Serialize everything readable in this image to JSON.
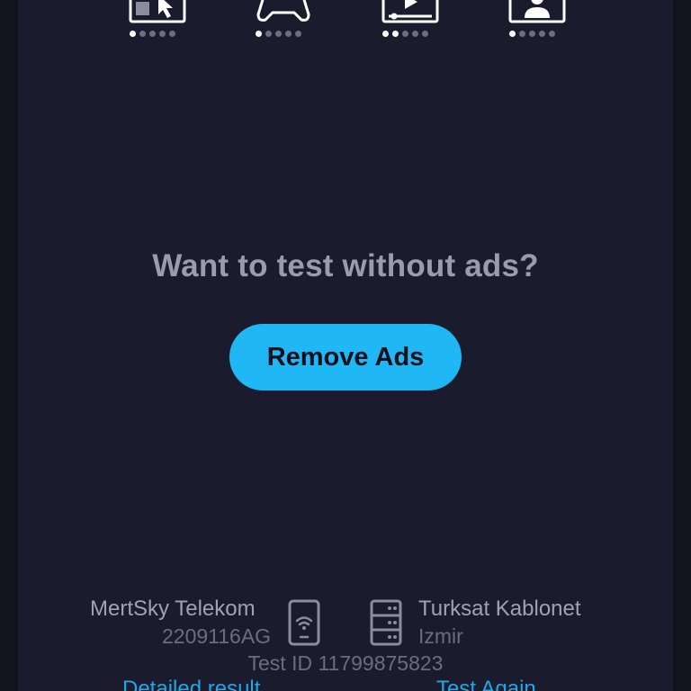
{
  "activities": [
    {
      "icon": "browsing-icon",
      "dots": 5,
      "active_dots": 1
    },
    {
      "icon": "gamepad-icon",
      "dots": 5,
      "active_dots": 1
    },
    {
      "icon": "video-icon",
      "dots": 5,
      "active_dots": 2
    },
    {
      "icon": "video-call-icon",
      "dots": 5,
      "active_dots": 1
    }
  ],
  "promo": {
    "title": "Want to test without ads?",
    "button_label": "Remove Ads"
  },
  "client": {
    "name": "MertSky Telekom",
    "device": "2209116AG",
    "icon": "phone-wifi-icon"
  },
  "server": {
    "name": "Turksat Kablonet",
    "location": "Izmir",
    "icon": "server-icon"
  },
  "test_id": "Test ID 11799875823",
  "links": {
    "detailed": "Detailed result",
    "again": "Test Again"
  },
  "colors": {
    "background": "#1a1c2e",
    "accent": "#1fb8f5",
    "link": "#1fa8e8"
  }
}
